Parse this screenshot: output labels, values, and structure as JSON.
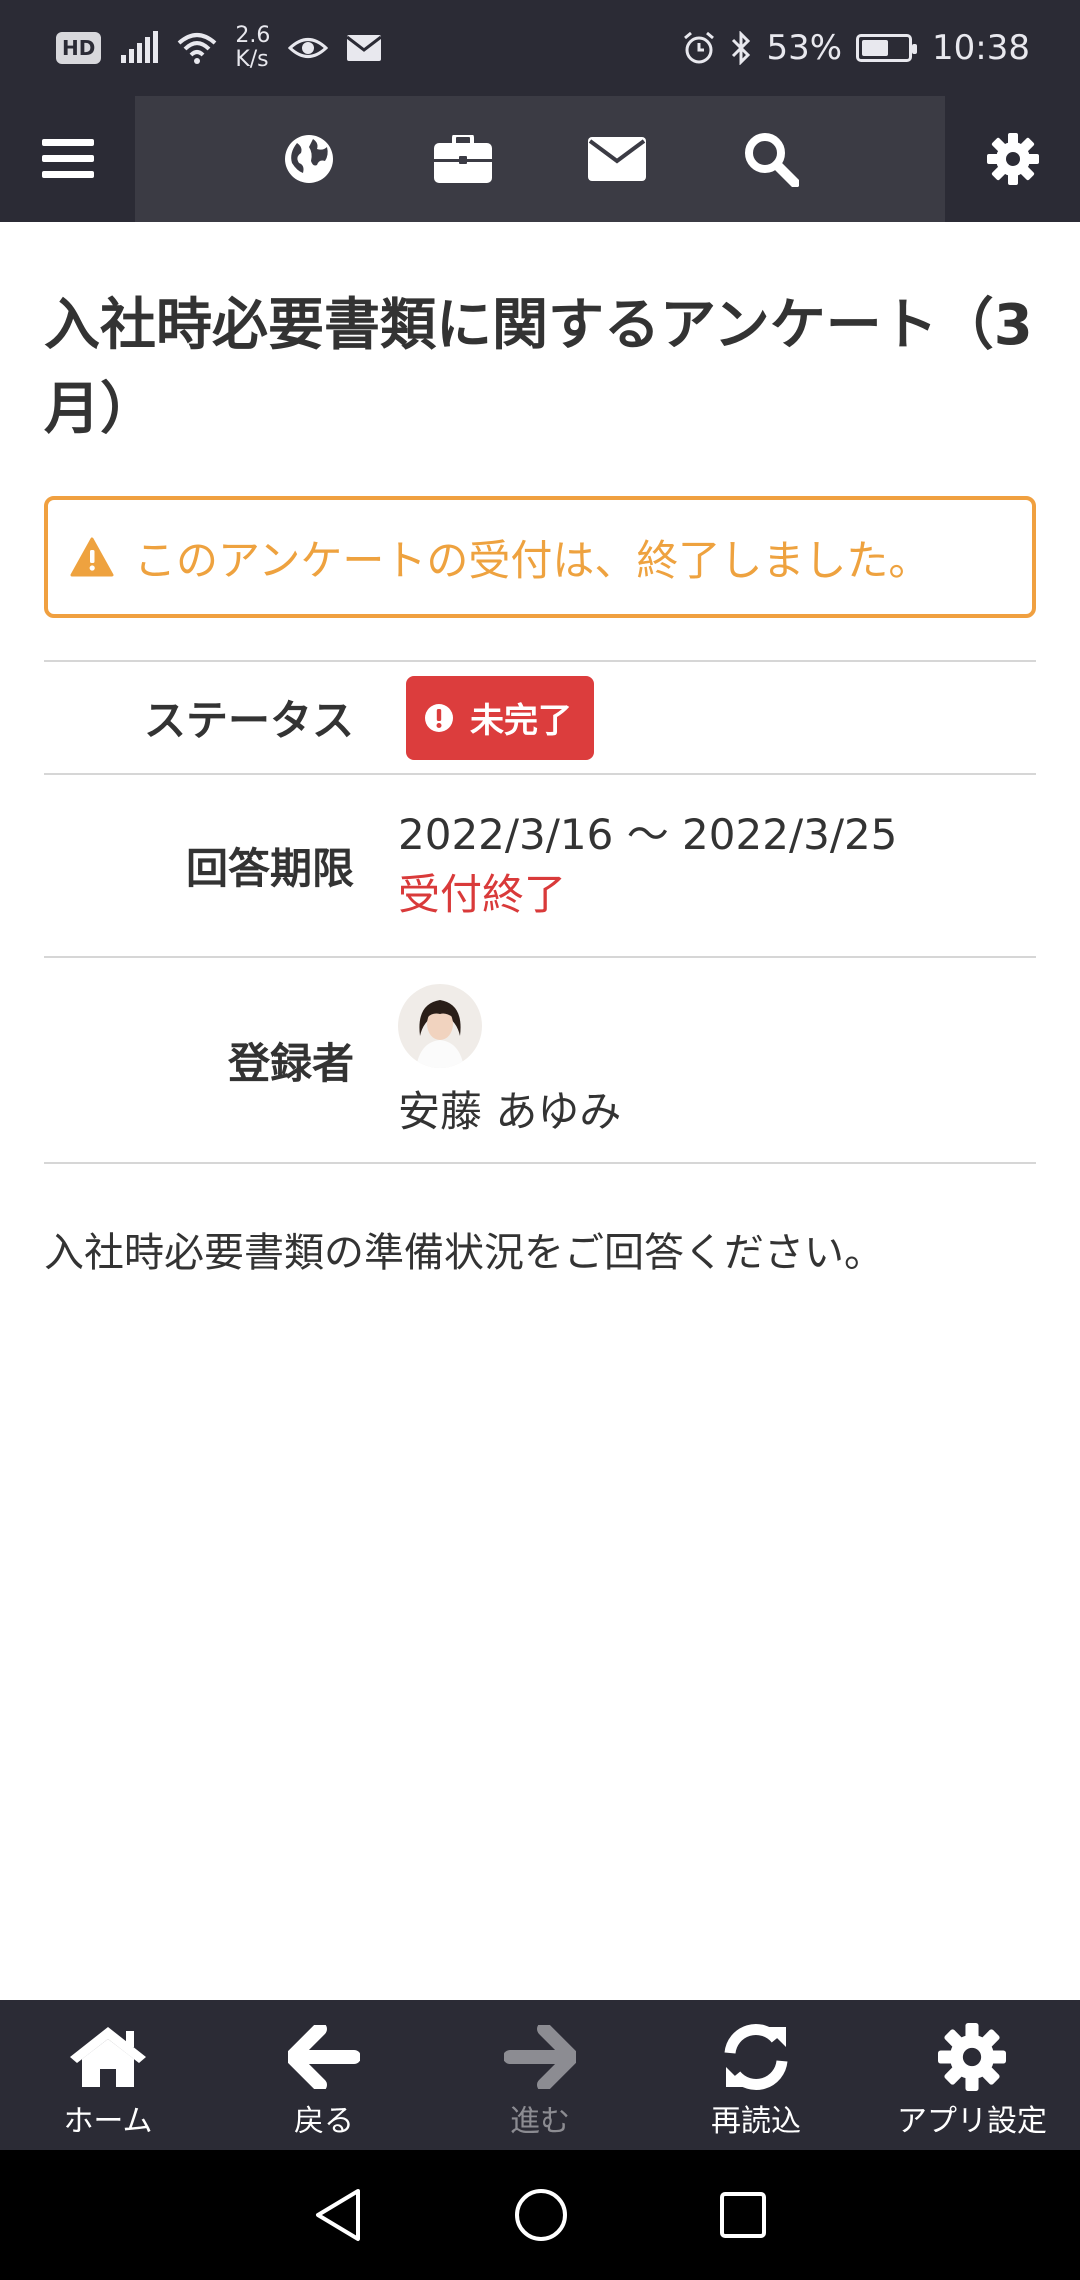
{
  "status_bar": {
    "hd": "HD",
    "net_speed_value": "2.6",
    "net_speed_unit": "K/s",
    "battery_percent": "53%",
    "time": "10:38"
  },
  "page": {
    "title": "入社時必要書類に関するアンケート（3月）",
    "alert_text": "このアンケートの受付は、終了しました。",
    "status_label": "ステータス",
    "status_badge": "未完了",
    "deadline_label": "回答期限",
    "deadline_range": "2022/3/16 〜 2022/3/25",
    "deadline_state": "受付終了",
    "registrant_label": "登録者",
    "registrant_name": "安藤 あゆみ",
    "description": "入社時必要書類の準備状況をご回答ください。"
  },
  "bottom_tabs": [
    {
      "label": "ホーム",
      "icon": "home-icon"
    },
    {
      "label": "戻る",
      "icon": "arrow-left-icon"
    },
    {
      "label": "進む",
      "icon": "arrow-right-icon"
    },
    {
      "label": "再読込",
      "icon": "refresh-icon"
    },
    {
      "label": "アプリ設定",
      "icon": "gear-icon"
    }
  ],
  "colors": {
    "bar_bg": "#2b2b35",
    "warning": "#eea23f",
    "danger": "#dc3d3d"
  }
}
